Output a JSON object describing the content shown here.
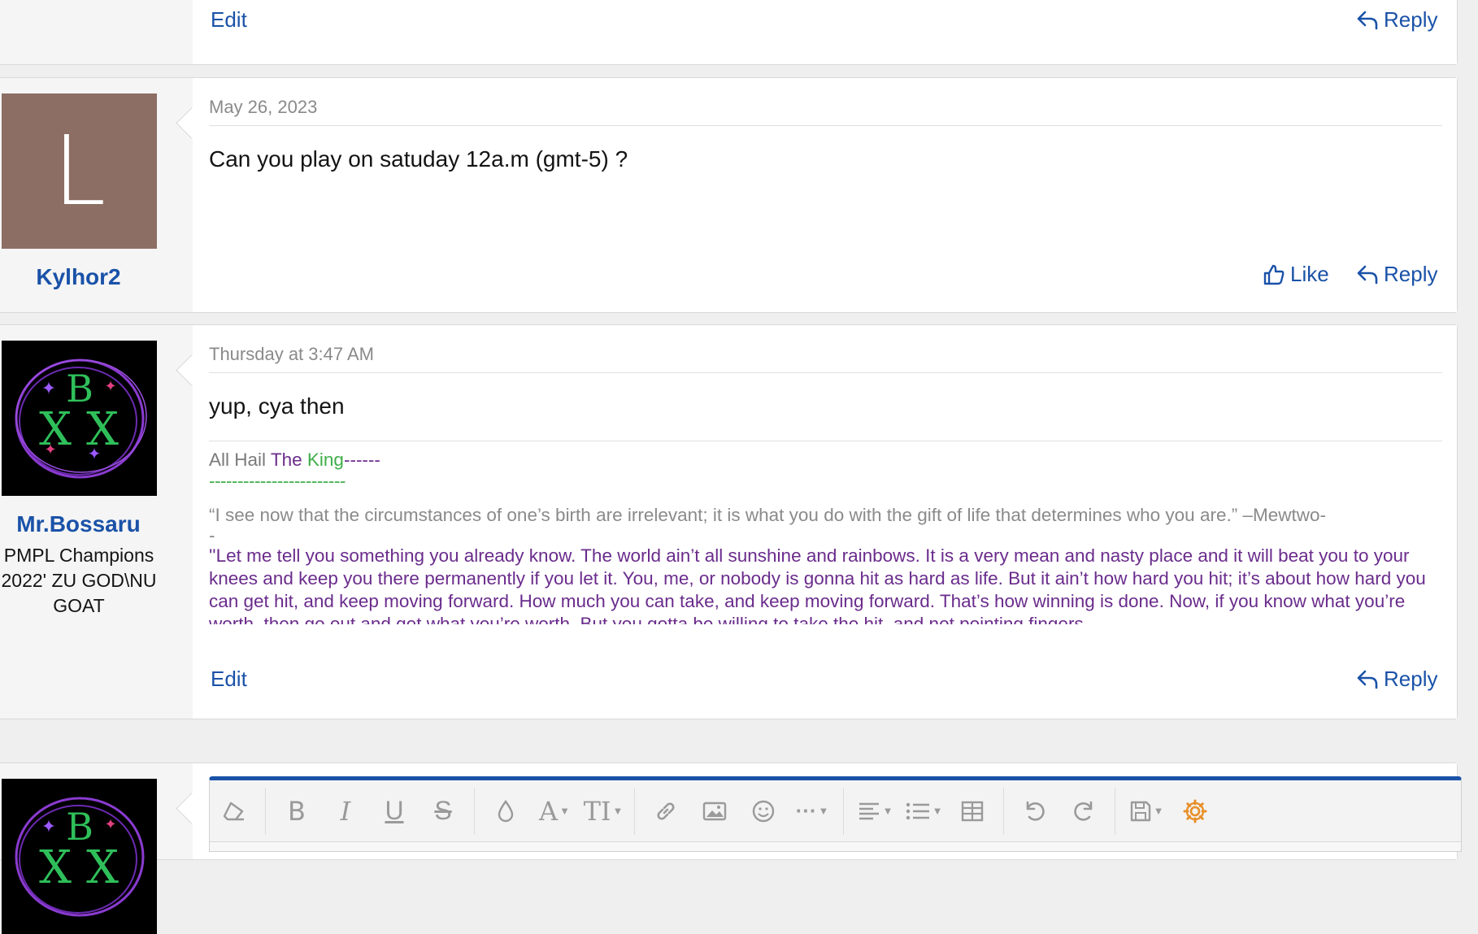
{
  "post1": {
    "edit_label": "Edit",
    "reply_label": "Reply"
  },
  "post2": {
    "avatar_letter": "L",
    "username": "Kylhor2",
    "date": "May 26, 2023",
    "body": "Can you play on satuday 12a.m (gmt-5) ?",
    "like_label": "Like",
    "reply_label": "Reply"
  },
  "post3": {
    "username": "Mr.Bossaru",
    "user_title": "PMPL Champions 2022' ZU GOD\\NU GOAT",
    "date": "Thursday at 3:47 AM",
    "body": "yup, cya then",
    "signature": {
      "part_all_hail": "All Hail ",
      "part_the": "The ",
      "part_king": "King",
      "part_dashes1": "------",
      "part_dashes2": "------------------------",
      "quote": "“I see now that the circumstances of one’s birth are irrelevant; it is what you do with the gift of life that determines who you are.” –Mewtwo-",
      "quote_end": "-",
      "long_quote": "''Let me tell you something you already know. The world ain’t all sunshine and rainbows. It is a very mean and nasty place and it will beat you to your knees and keep you there permanently if you let it. You, me, or nobody is gonna hit as hard as life. But it ain’t how hard you hit; it’s about how hard you can get hit, and keep moving forward. How much you can take, and keep moving forward. That’s how winning is done. Now, if you know what you’re worth, then go out and get what you’re worth. But you gotta be willing to take the hit, and not pointing fingers"
    },
    "edit_label": "Edit",
    "reply_label": "Reply"
  },
  "editor": {
    "toolbar_icons": [
      "eraser-icon",
      "bold-icon",
      "italic-icon",
      "underline-icon",
      "strikethrough-icon",
      "text-color-icon",
      "font-family-icon",
      "font-size-icon",
      "link-icon",
      "image-icon",
      "emoji-icon",
      "more-icon",
      "align-icon",
      "list-icon",
      "table-icon",
      "undo-icon",
      "redo-icon",
      "drafts-icon",
      "settings-icon"
    ],
    "bold_glyph": "B",
    "italic_glyph": "I",
    "underline_glyph": "U",
    "strike_glyph": "S",
    "font_glyph": "A",
    "size_glyph": "TI",
    "more_glyph": "···"
  },
  "colors": {
    "link_blue": "#1a52a8",
    "avatar_brown": "#8c6e64",
    "sig_purple": "#6a2c8c",
    "sig_green": "#3fae4a",
    "settings_orange": "#e8902a"
  }
}
